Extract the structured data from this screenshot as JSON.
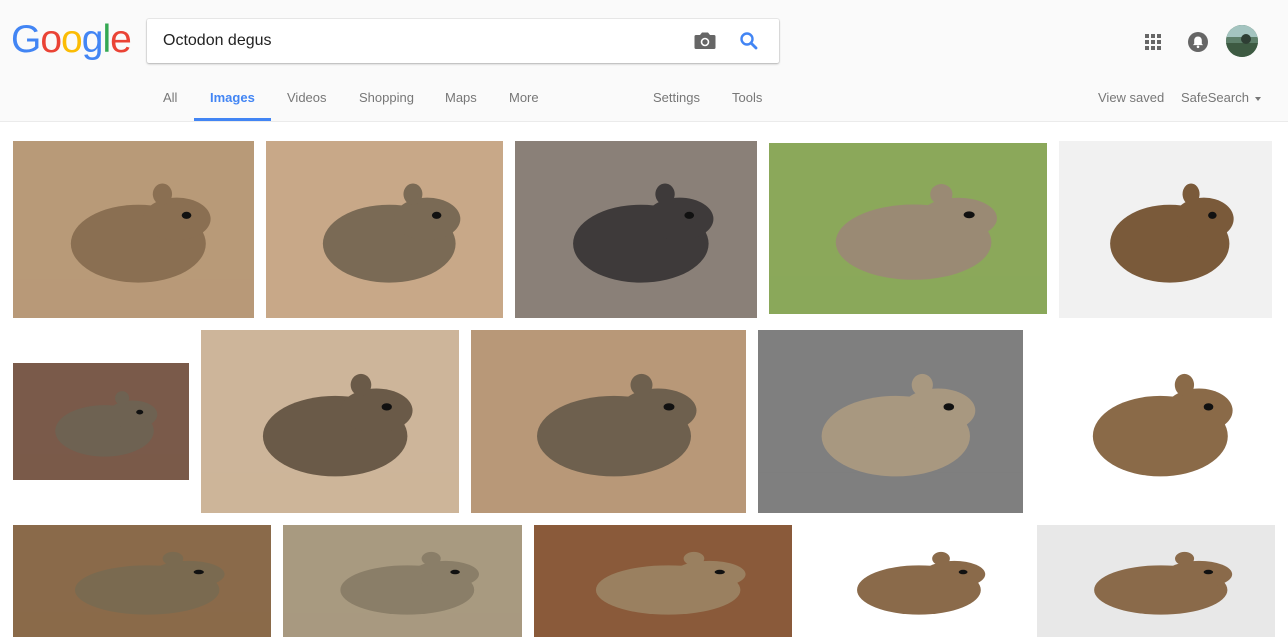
{
  "logo": {
    "letters": [
      "G",
      "o",
      "o",
      "g",
      "l",
      "e"
    ],
    "colors": [
      "#4285f4",
      "#ea4335",
      "#fbbc05",
      "#4285f4",
      "#34a853",
      "#ea4335"
    ]
  },
  "search": {
    "query": "Octodon degus",
    "camera_icon": "camera-icon",
    "search_icon": "magnifier-icon"
  },
  "nav": {
    "all": "All",
    "images": "Images",
    "videos": "Videos",
    "shopping": "Shopping",
    "maps": "Maps",
    "more": "More",
    "settings": "Settings",
    "tools": "Tools",
    "view_saved": "View saved",
    "safesearch": "SafeSearch"
  },
  "header_icons": [
    "apps-grid-icon",
    "notifications-bell-icon",
    "account-avatar"
  ],
  "colors": {
    "accent": "#4285f4",
    "nav_text": "#777777",
    "bar_bg": "#fafafa"
  },
  "results": [
    {
      "id": 1,
      "bg": "#b89a78",
      "body": "#8a6f52"
    },
    {
      "id": 2,
      "bg": "#c8a888",
      "body": "#7a6a55"
    },
    {
      "id": 3,
      "bg": "#8a8078",
      "body": "#3e3a3a"
    },
    {
      "id": 4,
      "bg": "#8ba85a",
      "body": "#9a8a74"
    },
    {
      "id": 5,
      "bg": "#f1f1f1",
      "body": "#7a5a3a"
    },
    {
      "id": 6,
      "bg": "#7a5a4a",
      "body": "#6e6252"
    },
    {
      "id": 7,
      "bg": "#cdb59a",
      "body": "#6a5a48"
    },
    {
      "id": 8,
      "bg": "#b89878",
      "body": "#6e604e"
    },
    {
      "id": 9,
      "bg": "#7f7f7f",
      "body": "#a89880"
    },
    {
      "id": 10,
      "bg": "#ffffff",
      "body": "#8a6a48"
    },
    {
      "id": 11,
      "bg": "#8a6a4a",
      "body": "#7a6a50"
    },
    {
      "id": 12,
      "bg": "#a89a80",
      "body": "#8a7e68"
    },
    {
      "id": 13,
      "bg": "#8a5a3a",
      "body": "#9a8060"
    },
    {
      "id": 14,
      "bg": "#ffffff",
      "body": "#8a6a4a"
    },
    {
      "id": 15,
      "bg": "#e8e8e8",
      "body": "#8a6a4a"
    }
  ]
}
